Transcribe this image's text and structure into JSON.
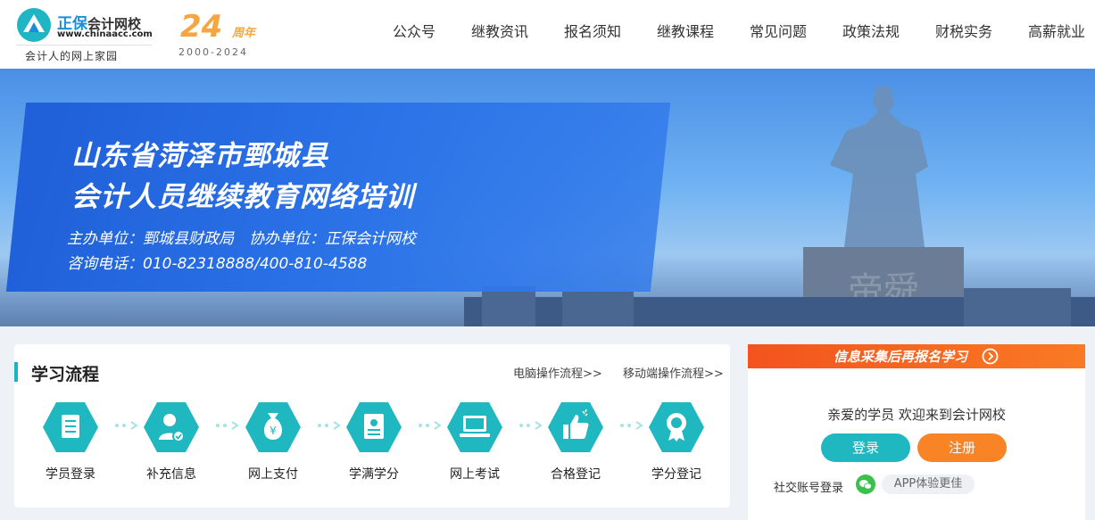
{
  "header": {
    "logo": {
      "name": "正保",
      "name_sub": "会计网校",
      "url": "www.chinaacc.com",
      "tagline": "会计人的网上家园",
      "icon": "logo-icon"
    },
    "anniversary": {
      "number": "24",
      "unit": "周年",
      "years": "2000-2024"
    },
    "nav": [
      {
        "label": "公众号"
      },
      {
        "label": "继教资讯"
      },
      {
        "label": "报名须知"
      },
      {
        "label": "继教课程"
      },
      {
        "label": "常见问题"
      },
      {
        "label": "政策法规"
      },
      {
        "label": "财税实务"
      },
      {
        "label": "高薪就业"
      }
    ]
  },
  "banner": {
    "title_line1": "山东省菏泽市鄄城县",
    "title_line2": "会计人员继续教育网络培训",
    "organizer": "主办单位：鄄城县财政局　协办单位：正保会计网校",
    "phone": "咨询电话：010-82318888/400-810-4588",
    "statue_text": "帝舜"
  },
  "process": {
    "title": "学习流程",
    "links": [
      {
        "label": "电脑操作流程>>"
      },
      {
        "label": "移动端操作流程>>"
      }
    ],
    "steps": [
      {
        "label": "学员登录",
        "icon": "clipboard-icon"
      },
      {
        "label": "补充信息",
        "icon": "user-check-icon"
      },
      {
        "label": "网上支付",
        "icon": "money-bag-icon"
      },
      {
        "label": "学满学分",
        "icon": "id-card-icon"
      },
      {
        "label": "网上考试",
        "icon": "laptop-icon"
      },
      {
        "label": "合格登记",
        "icon": "thumbs-up-icon"
      },
      {
        "label": "学分登记",
        "icon": "medal-icon"
      }
    ]
  },
  "side": {
    "header": "信息采集后再报名学习",
    "welcome": "亲爱的学员 欢迎来到会计网校",
    "login": "登录",
    "register": "注册",
    "social_label": "社交账号登录",
    "app_chip": "APP体验更佳"
  },
  "colors": {
    "teal": "#1fb8c1",
    "orange": "#f98425",
    "brand_blue": "#1a8fd8",
    "banner_blue": "#2c73e8"
  }
}
